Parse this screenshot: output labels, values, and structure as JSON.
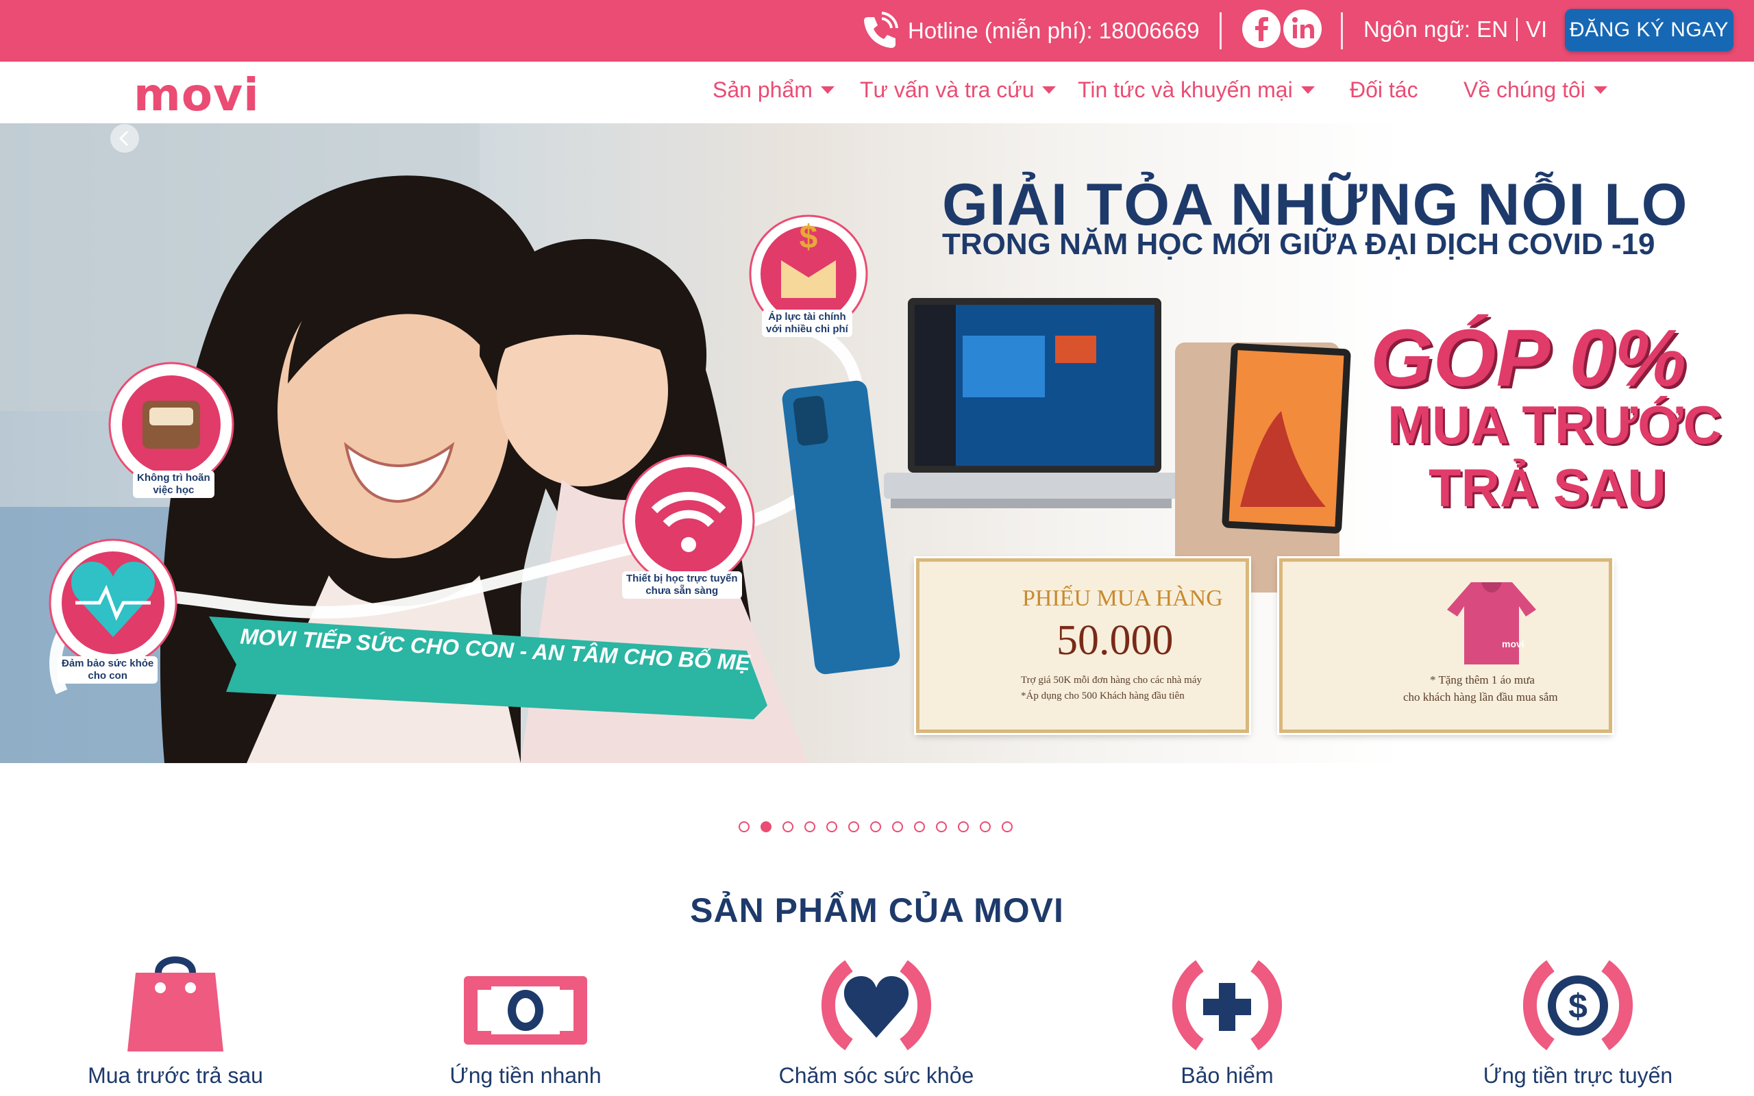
{
  "topbar": {
    "hotline": "Hotline (miễn phí): 18006669",
    "language_label": "Ngôn ngữ:",
    "lang_en": "EN",
    "lang_vi": "VI",
    "cta": "ĐĂNG KÝ NGAY",
    "background": "#ea4c73",
    "cta_color": "#1768b4"
  },
  "brand": {
    "logo": "movi",
    "color": "#ea4c73"
  },
  "nav": {
    "items": [
      {
        "label": "Sản phẩm"
      },
      {
        "label": "Tư vấn và tra cứu"
      },
      {
        "label": "Tin tức và khuyến mại"
      },
      {
        "label": "Đối tác"
      },
      {
        "label": "Về chúng tôi"
      }
    ]
  },
  "hero": {
    "title": "GIẢI TỎA NHỮNG NỖI LO",
    "subtitle": "TRONG NĂM HỌC MỚI GIỮA ĐẠI DỊCH COVID -19",
    "promo_line1": "GÓP 0%",
    "promo_line2": "MUA TRƯỚC",
    "promo_line3": "TRẢ SAU",
    "bubbles": [
      {
        "label_1": "Áp lực tài chính",
        "label_2": "với nhiều chi phí"
      },
      {
        "label_1": "Không trì hoãn",
        "label_2": "việc học"
      },
      {
        "label_1": "Thiết bị học trực tuyến",
        "label_2": "chưa sẵn sàng"
      },
      {
        "label_1": "Đảm bảo sức khỏe",
        "label_2": "cho con"
      }
    ],
    "banner": "MOVI TIẾP SỨC CHO CON - AN TÂM CHO BỐ MẸ",
    "voucher1": {
      "title": "PHIẾU MUA HÀNG",
      "amount": "50.000",
      "note1": "Trợ giá 50K mỗi đơn hàng cho các nhà máy",
      "note2": "*Áp dụng cho 500 Khách hàng đầu tiên"
    },
    "voucher2": {
      "note1": "* Tặng thêm 1 áo mưa",
      "note2": "cho khách hàng lần đầu mua sắm",
      "shirt_logo": "movi"
    }
  },
  "carousel": {
    "total": 13,
    "active": 2
  },
  "products": {
    "title": "SẢN PHẨM CỦA MOVI",
    "items": [
      {
        "label": "Mua trước trả sau",
        "icon": "shopping-bag-icon"
      },
      {
        "label": "Ứng tiền nhanh",
        "icon": "banknote-icon"
      },
      {
        "label": "Chăm sóc sức khỏe",
        "icon": "heart-care-icon"
      },
      {
        "label": "Bảo hiểm",
        "icon": "plus-shield-icon"
      },
      {
        "label": "Ứng tiền trực tuyến",
        "icon": "dollar-online-icon"
      }
    ]
  }
}
